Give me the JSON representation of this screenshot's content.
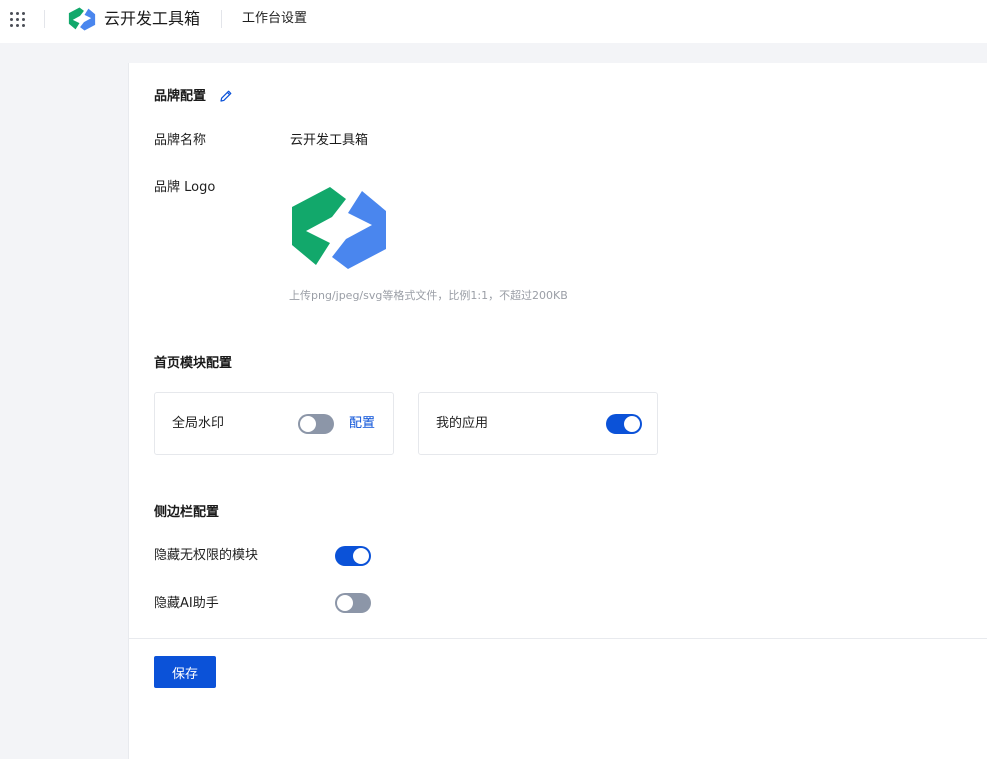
{
  "header": {
    "brand_name": "云开发工具箱",
    "page_title": "工作台设置"
  },
  "brand_section": {
    "title": "品牌配置",
    "name_label": "品牌名称",
    "name_value": "云开发工具箱",
    "logo_label": "品牌 Logo",
    "logo_hint": "上传png/jpeg/svg等格式文件，比例1:1，不超过200KB"
  },
  "home_section": {
    "title": "首页模块配置",
    "modules": [
      {
        "label": "全局水印",
        "enabled": false,
        "action_label": "配置"
      },
      {
        "label": "我的应用",
        "enabled": true
      }
    ]
  },
  "sidebar_section": {
    "title": "侧边栏配置",
    "options": [
      {
        "label": "隐藏无权限的模块",
        "enabled": true
      },
      {
        "label": "隐藏AI助手",
        "enabled": false
      }
    ]
  },
  "footer": {
    "save_label": "保存"
  },
  "colors": {
    "primary": "#0b52d8",
    "toggle_off": "#8c96a8",
    "logo_green": "#12a86b",
    "logo_blue": "#4a86ee",
    "page_bg": "#f3f4f7"
  },
  "icons": {
    "apps": "grid-dots-icon",
    "edit": "pencil-icon",
    "logo": "brand-logo"
  }
}
